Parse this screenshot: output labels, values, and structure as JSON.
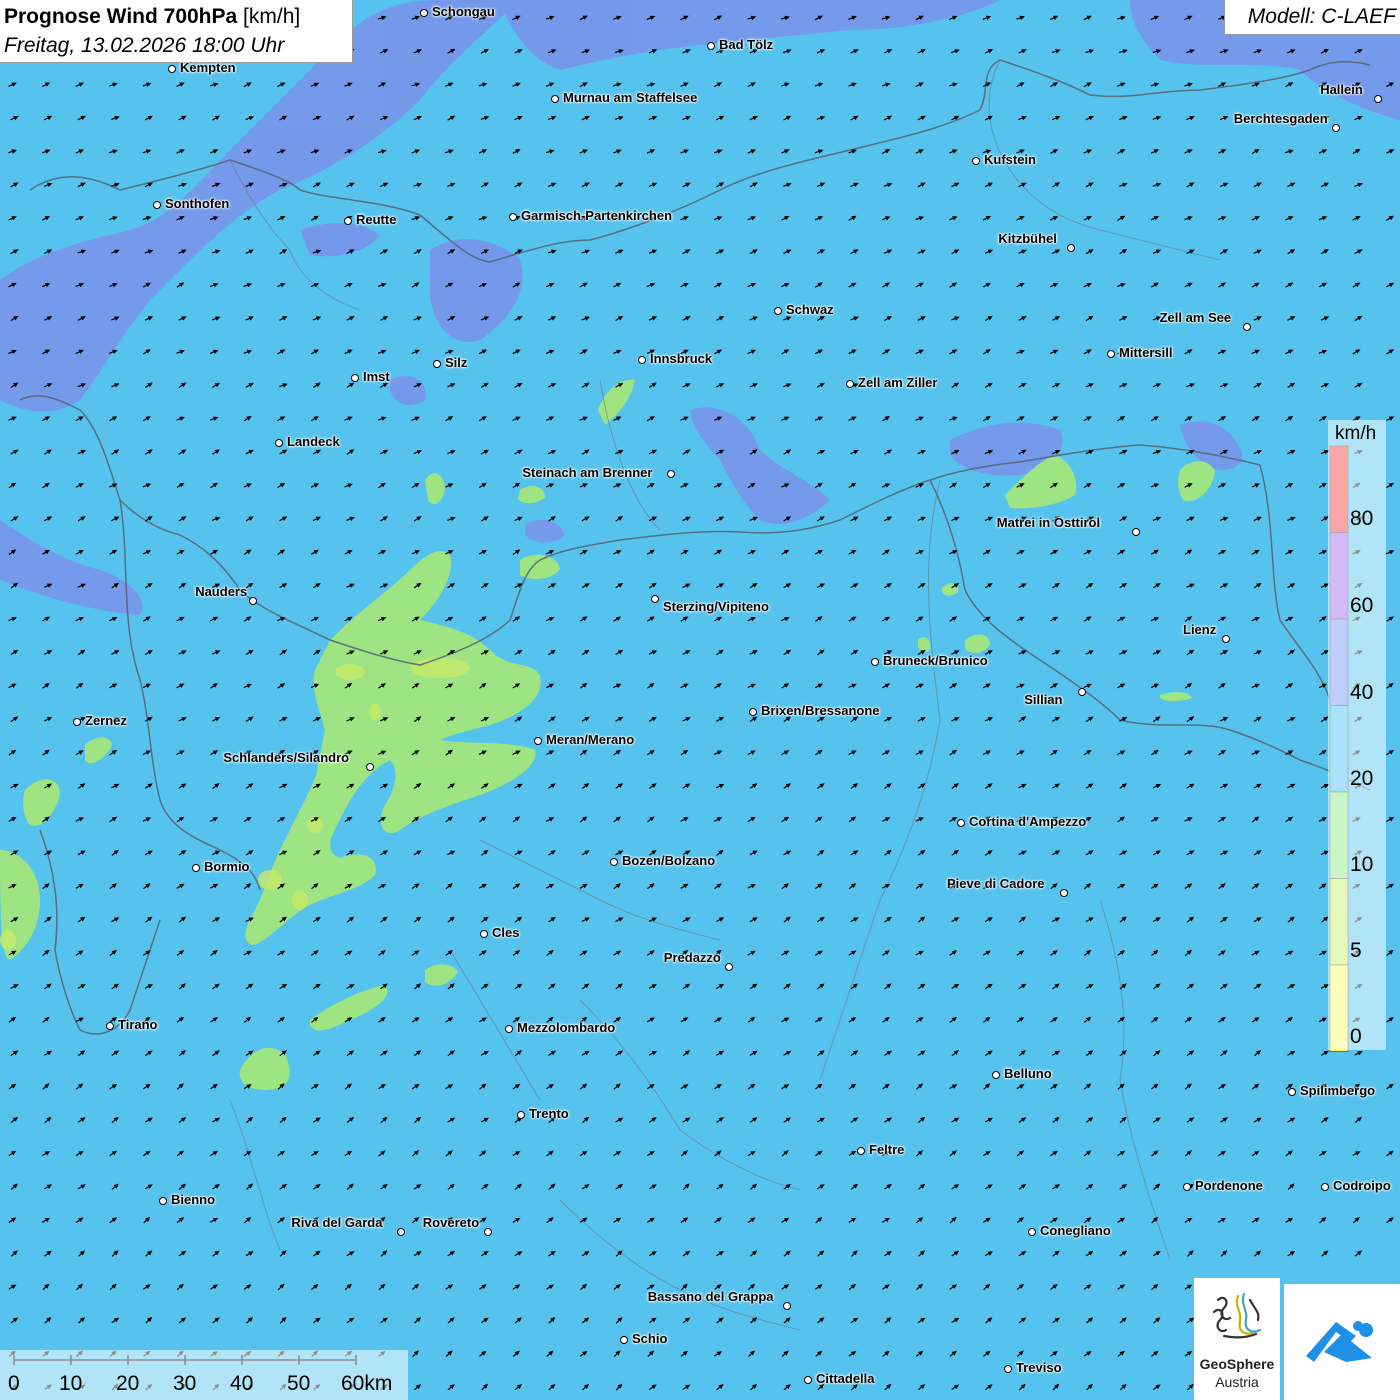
{
  "title": {
    "main": "Prognose Wind 700hPa",
    "unit": "[km/h]",
    "datetime": "Freitag, 13.02.2026 18:00 Uhr"
  },
  "model": "Modell: C-LAEF",
  "legend": {
    "unit": "km/h",
    "labels": [
      "80",
      "60",
      "40",
      "20",
      "10",
      "5",
      "0"
    ],
    "bands": [
      {
        "color": "#ee3b3b"
      },
      {
        "color": "#9966ee"
      },
      {
        "color": "#6e92ef"
      },
      {
        "color": "#3fc1ee"
      },
      {
        "color": "#87ea87"
      },
      {
        "color": "#ccf066"
      },
      {
        "color": "#ffff66"
      }
    ]
  },
  "cities": [
    "Schongau",
    "Bad Tölz",
    "Kempten",
    "Murnau am Staffelsee",
    "Hallein",
    "Berchtesgaden",
    "Kufstein",
    "Sonthofen",
    "Reutte",
    "Garmisch-Partenkirchen",
    "Kitzbühel",
    "Schwaz",
    "Zell am See",
    "Mittersill",
    "Imst",
    "Silz",
    "Innsbruck",
    "Zell am Ziller",
    "Landeck",
    "Steinach am Brenner",
    "Matrei in Osttirol",
    "Nauders",
    "Sterzing/Vipiteno",
    "Lienz",
    "Bruneck/Brunico",
    "Sillian",
    "Zernez",
    "Brixen/Bressanone",
    "Meran/Merano",
    "Schlanders/Silandro",
    "Cortina d'Ampezzo",
    "Bormio",
    "Bozen/Bolzano",
    "Pieve di Cadore",
    "Cles",
    "Predazzo",
    "Tirano",
    "Mezzolombardo",
    "Belluno",
    "Spilimbergo",
    "Trento",
    "Feltre",
    "Bienno",
    "Pordenone",
    "Codroipo",
    "Riva del Garda",
    "Rovereto",
    "Conegliano",
    "Bassano del Grappa",
    "Schio",
    "Treviso",
    "Cittadella"
  ],
  "scale": {
    "labels": [
      "0",
      "10",
      "20",
      "30",
      "40",
      "50",
      "60km"
    ]
  },
  "logos": {
    "geosphere_line1": "GeoSphere",
    "geosphere_line2": "Austria",
    "geosphere_icon": "geosphere-logo",
    "second_icon": "cloud-arrow-logo"
  },
  "colors": {
    "background": "#56c3ee",
    "strong_wind": "#7a8ee8",
    "weak_wind": "#9ee483",
    "arrow": "#000000"
  }
}
